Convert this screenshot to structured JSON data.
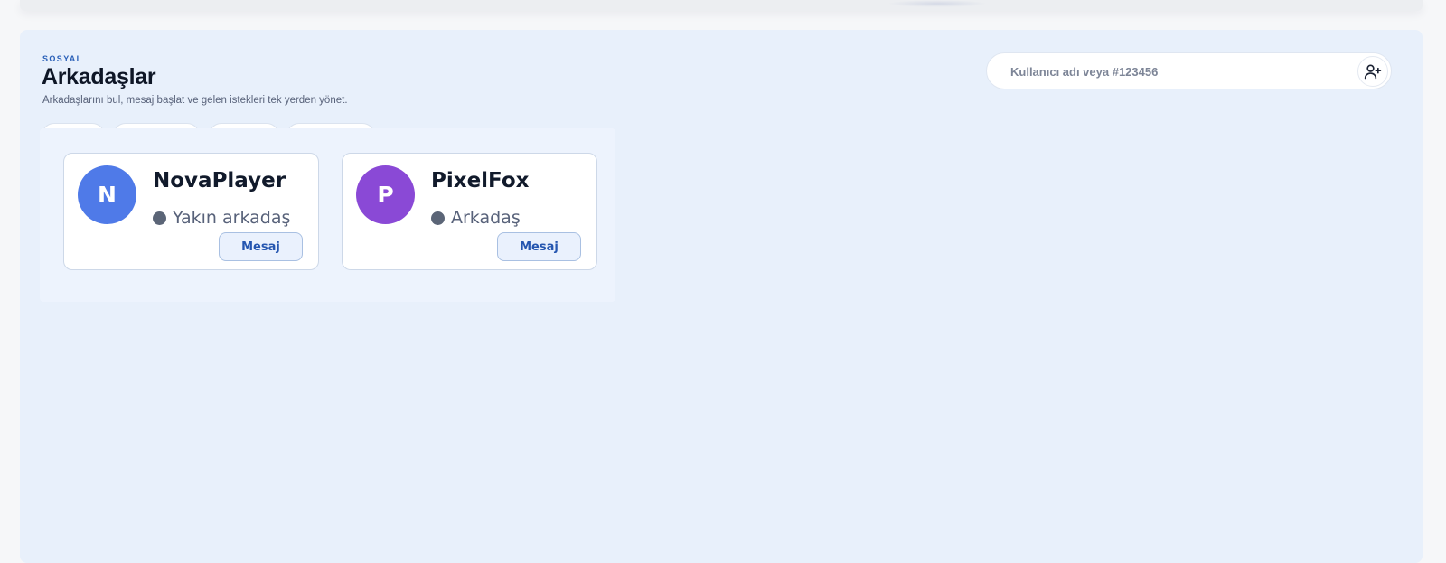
{
  "header": {
    "eyebrow": "SOSYAL",
    "title": "Arkadaşlar",
    "subtitle": "Arkadaşlarını bul, mesaj başlat ve gelen istekleri tek yerden yönet."
  },
  "search": {
    "placeholder": "Kullanıcı adı veya #123456",
    "value": "",
    "add_icon": "user-plus-icon"
  },
  "friends": [
    {
      "initial": "N",
      "name": "NovaPlayer",
      "status": "Yakın arkadaş",
      "avatar_color": "#4f7ae8",
      "action_label": "Mesaj"
    },
    {
      "initial": "P",
      "name": "PixelFox",
      "status": "Arkadaş",
      "avatar_color": "#8a49d6",
      "action_label": "Mesaj"
    }
  ],
  "colors": {
    "accent": "#2a60b8",
    "panel_bg": "#e8f0fb",
    "status_dot": "#5b6577"
  }
}
